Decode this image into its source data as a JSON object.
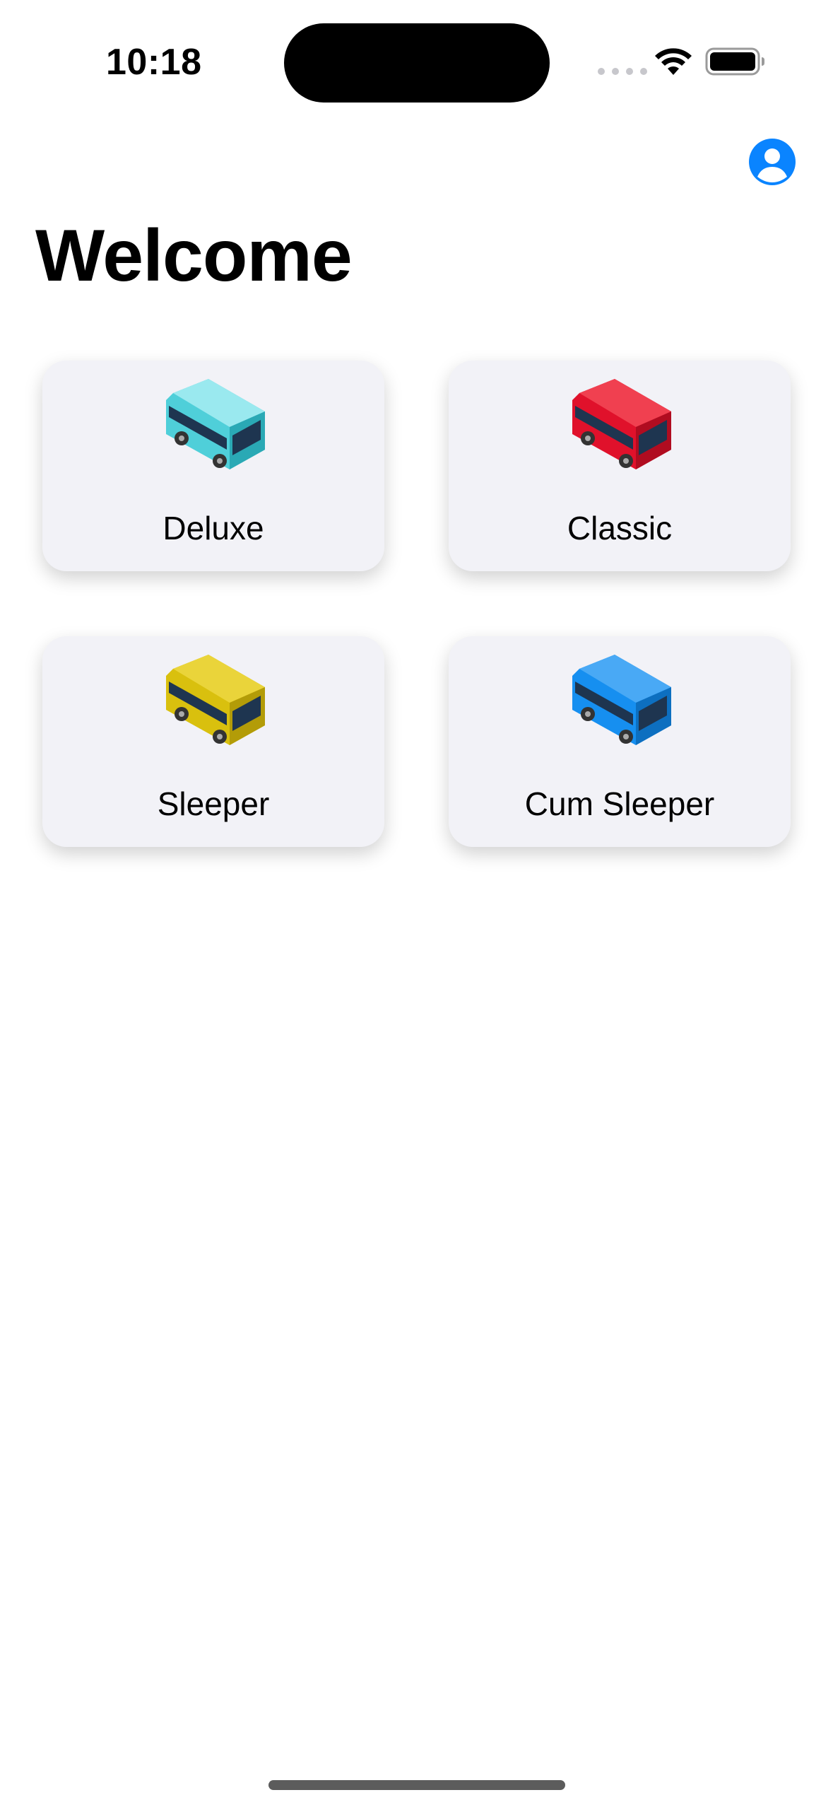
{
  "status_bar": {
    "time": "10:18",
    "wifi_icon": "wifi-icon",
    "battery_icon": "battery-icon"
  },
  "header": {
    "profile_icon": "person-circle-icon",
    "accent_color": "#0a84ff"
  },
  "page": {
    "title": "Welcome"
  },
  "bus_types": [
    {
      "label": "Deluxe",
      "icon": "bus-icon",
      "color": "#4fcfd9"
    },
    {
      "label": "Classic",
      "icon": "bus-icon",
      "color": "#e0112b"
    },
    {
      "label": "Sleeper",
      "icon": "bus-icon",
      "color": "#d9c00e"
    },
    {
      "label": "Cum Sleeper",
      "icon": "bus-icon",
      "color": "#168ff0"
    }
  ]
}
